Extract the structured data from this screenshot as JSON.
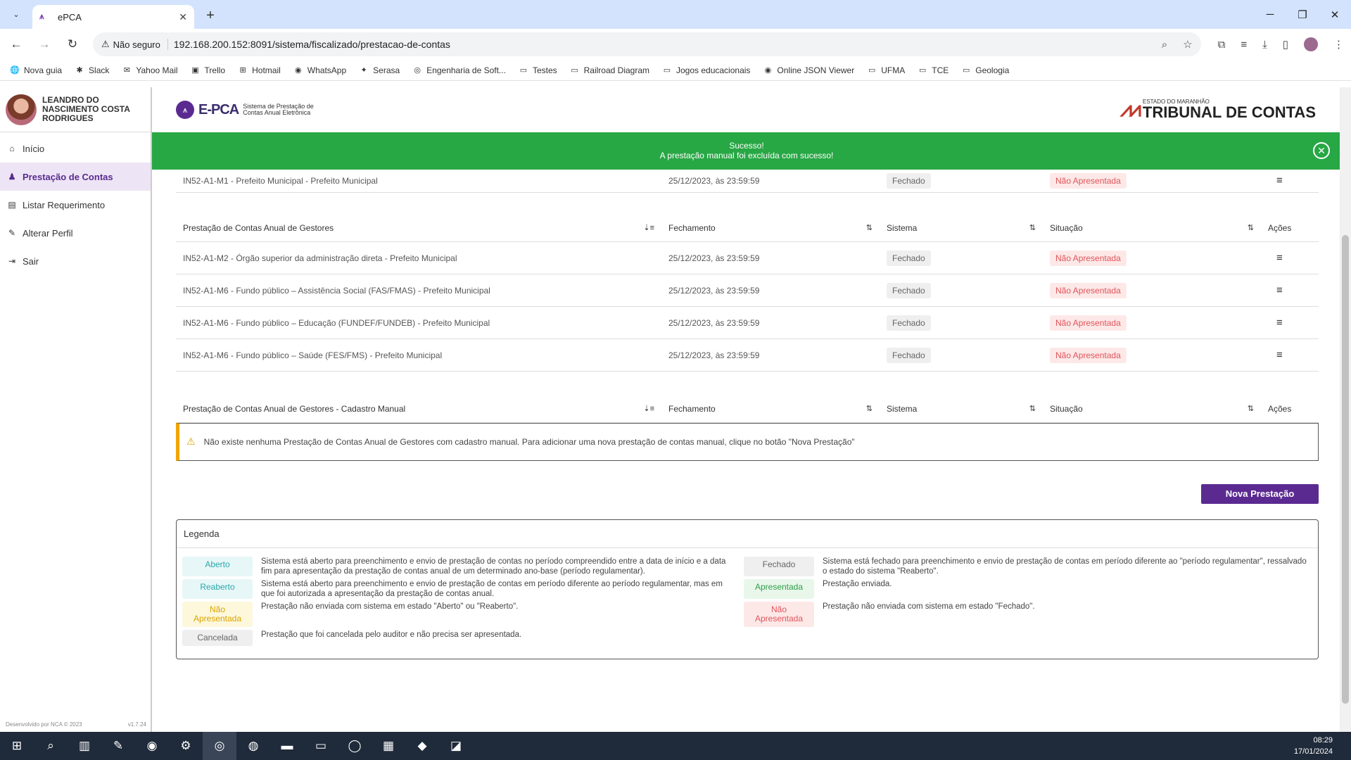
{
  "browser": {
    "tab_title": "ePCA",
    "insecure_label": "Não seguro",
    "url": "192.168.200.152:8091/sistema/fiscalizado/prestacao-de-contas",
    "bookmarks": [
      "Nova guia",
      "Slack",
      "Yahoo Mail",
      "Trello",
      "Hotmail",
      "WhatsApp",
      "Serasa",
      "Engenharia de Soft...",
      "Testes",
      "Railroad Diagram",
      "Jogos educacionais",
      "Online JSON Viewer",
      "UFMA",
      "TCE",
      "Geologia"
    ]
  },
  "sidebar": {
    "user_name": "LEANDRO DO NASCIMENTO COSTA RODRIGUES",
    "items": [
      {
        "label": "Início",
        "icon": "home-icon"
      },
      {
        "label": "Prestação de Contas",
        "icon": "user-icon"
      },
      {
        "label": "Listar Requerimento",
        "icon": "document-icon"
      },
      {
        "label": "Alterar Perfil",
        "icon": "user-edit-icon"
      },
      {
        "label": "Sair",
        "icon": "logout-icon"
      }
    ],
    "footer_left": "Desenvolvido por NCA © 2023",
    "footer_right": "v1.7.24"
  },
  "header": {
    "logo_text": "E-PCA",
    "logo_sub": "Sistema de Prestação de Contas Anual Eletrônica",
    "tce_small": "ESTADO DO MARANHÃO",
    "tce_big": "TRIBUNAL DE CONTAS"
  },
  "toast": {
    "title": "Sucesso!",
    "message": "A prestação manual foi excluída com sucesso!"
  },
  "top_row": {
    "name": "IN52-A1-M1 - Prefeito Municipal - Prefeito Municipal",
    "date": "25/12/2023, às 23:59:59",
    "system": "Fechado",
    "status": "Não Apresentada"
  },
  "table1": {
    "headers": [
      "Prestação de Contas Anual de Gestores",
      "Fechamento",
      "Sistema",
      "Situação",
      "Ações"
    ],
    "rows": [
      {
        "name": "IN52-A1-M2 - Órgão superior da administração direta - Prefeito Municipal",
        "date": "25/12/2023, às 23:59:59",
        "system": "Fechado",
        "status": "Não Apresentada"
      },
      {
        "name": "IN52-A1-M6 - Fundo público – Assistência Social (FAS/FMAS) - Prefeito Municipal",
        "date": "25/12/2023, às 23:59:59",
        "system": "Fechado",
        "status": "Não Apresentada"
      },
      {
        "name": "IN52-A1-M6 - Fundo público – Educação (FUNDEF/FUNDEB) - Prefeito Municipal",
        "date": "25/12/2023, às 23:59:59",
        "system": "Fechado",
        "status": "Não Apresentada"
      },
      {
        "name": "IN52-A1-M6 - Fundo público – Saúde (FES/FMS) - Prefeito Municipal",
        "date": "25/12/2023, às 23:59:59",
        "system": "Fechado",
        "status": "Não Apresentada"
      }
    ]
  },
  "table2": {
    "headers": [
      "Prestação de Contas Anual de Gestores - Cadastro Manual",
      "Fechamento",
      "Sistema",
      "Situação",
      "Ações"
    ],
    "empty_message": "Não existe nenhuma Prestação de Contas Anual de Gestores com cadastro manual. Para adicionar uma nova prestação de contas manual, clique no botão \"Nova Prestação\""
  },
  "new_button": "Nova Prestação",
  "legend": {
    "title": "Legenda",
    "aberto_label": "Aberto",
    "aberto_desc": "Sistema está aberto para preenchimento e envio de prestação de contas no período compreendido entre a data de início e a data fim para apresentação da prestação de contas anual de um determinado ano-base (período regulamentar).",
    "fechado_label": "Fechado",
    "fechado_desc": "Sistema está fechado para preenchimento e envio de prestação de contas em período diferente ao \"período regulamentar\", ressalvado o estado do sistema \"Reaberto\".",
    "reaberto_label": "Reaberto",
    "reaberto_desc": "Sistema está aberto para preenchimento e envio de prestação de contas em período diferente ao período regulamentar, mas em que foi autorizada a apresentação da prestação de contas anual.",
    "apresentada_label": "Apresentada",
    "apresentada_desc": "Prestação enviada.",
    "nao_aberto_label": "Não Apresentada",
    "nao_aberto_desc": "Prestação não enviada com sistema em estado \"Aberto\" ou \"Reaberto\".",
    "nao_fechado_label": "Não Apresentada",
    "nao_fechado_desc": "Prestação não enviada com sistema em estado \"Fechado\".",
    "cancelada_label": "Cancelada",
    "cancelada_desc": "Prestação que foi cancelada pelo auditor e não precisa ser apresentada."
  },
  "taskbar": {
    "time": "08:29",
    "date": "17/01/2024"
  }
}
